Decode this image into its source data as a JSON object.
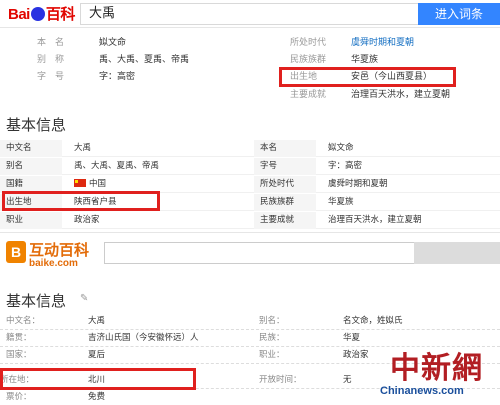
{
  "baidu": {
    "logo_left": "Bai",
    "logo_right": "百科",
    "search_value": "大禹",
    "search_button": "进入词条"
  },
  "top_info": {
    "rows": [
      {
        "label": "本名",
        "value": "姒文命",
        "label2": "所处时代",
        "value2": "虞舜时期和夏朝"
      },
      {
        "label": "别称",
        "value": "禹、大禹、夏禹、帝禹",
        "label2": "民族族群",
        "value2": "华夏族"
      },
      {
        "label": "字号",
        "value": "字：高密",
        "label2": "出生地",
        "value2": "安邑（今山西夏县）"
      },
      {
        "label": "",
        "value": "",
        "label2": "主要成就",
        "value2": "治理百天洪水，建立夏朝"
      }
    ]
  },
  "basic_info": {
    "title": "基本信息",
    "rows": [
      {
        "l1": "中文名",
        "v1": "大禹",
        "l2": "本名",
        "v2": "姒文命"
      },
      {
        "l1": "别名",
        "v1": "禹、大禹、夏禹、帝禹",
        "l2": "字号",
        "v2": "字：高密"
      },
      {
        "l1": "国籍",
        "v1": "中国",
        "l2": "所处时代",
        "v2": "虞舜时期和夏朝"
      },
      {
        "l1": "出生地",
        "v1": "陕西省户县",
        "l2": "民族族群",
        "v2": "华夏族"
      },
      {
        "l1": "职业",
        "v1": "政治家",
        "l2": "主要成就",
        "v2": "治理百天洪水，建立夏朝"
      }
    ]
  },
  "hudong": {
    "logo_icon": "B",
    "title": "互动百科",
    "url": "baike.com",
    "section_title": "基本信息",
    "rows": [
      {
        "l1": "中文名：",
        "v1": "大禹",
        "l2": "别名：",
        "v2": "名文命，姓姒氏"
      },
      {
        "l1": "籍贯：",
        "v1": "吉济山氏国（今安徽怀远）人",
        "l2": "民族：",
        "v2": "华夏"
      },
      {
        "l1": "国家：",
        "v1": "夏后",
        "l2": "职业：",
        "v2": "政治家"
      },
      {
        "l1": "所在地：",
        "v1": "北川",
        "l2": "开放时间：",
        "v2": "无"
      },
      {
        "l1": "票价：",
        "v1": "免费",
        "l2": "",
        "v2": ""
      }
    ]
  },
  "watermark": {
    "cn": "中新網",
    "en": "Chinanews.com"
  },
  "colors": {
    "highlight_border": "#e0201e",
    "baidu_blue": "#3385ff",
    "hudong_orange": "#e36c09"
  }
}
